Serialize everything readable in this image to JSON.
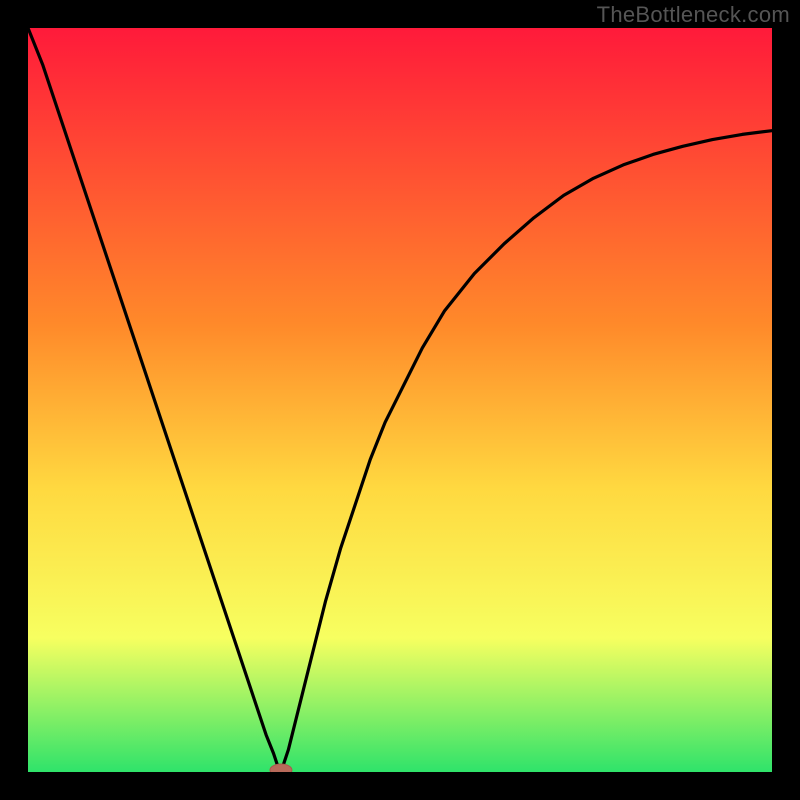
{
  "watermark": "TheBottleneck.com",
  "colors": {
    "bg": "#000000",
    "grad_top": "#ff1a3a",
    "grad_mid1": "#ff8a2a",
    "grad_mid2": "#ffd940",
    "grad_mid3": "#f7ff60",
    "grad_bottom": "#2fe36a",
    "curve": "#000000",
    "marker_fill": "#b86a5a",
    "marker_stroke": "#a85a4c"
  },
  "chart_data": {
    "type": "line",
    "title": "",
    "xlabel": "",
    "ylabel": "",
    "xlim": [
      0,
      100
    ],
    "ylim": [
      0,
      100
    ],
    "series": [
      {
        "name": "left-branch",
        "x": [
          0,
          2,
          4,
          6,
          8,
          10,
          12,
          14,
          16,
          18,
          20,
          22,
          24,
          26,
          28,
          30,
          31,
          32,
          33,
          33.5,
          34
        ],
        "values": [
          100,
          95,
          89,
          83,
          77,
          71,
          65,
          59,
          53,
          47,
          41,
          35,
          29,
          23,
          17,
          11,
          8,
          5,
          2.5,
          1,
          0
        ]
      },
      {
        "name": "right-branch",
        "x": [
          34,
          35,
          36,
          37,
          38,
          39,
          40,
          42,
          44,
          46,
          48,
          50,
          53,
          56,
          60,
          64,
          68,
          72,
          76,
          80,
          84,
          88,
          92,
          96,
          100
        ],
        "values": [
          0,
          3,
          7,
          11,
          15,
          19,
          23,
          30,
          36,
          42,
          47,
          51,
          57,
          62,
          67,
          71,
          74.5,
          77.5,
          79.8,
          81.6,
          83.0,
          84.1,
          85.0,
          85.7,
          86.2
        ]
      }
    ],
    "markers": [
      {
        "name": "vertex-marker",
        "x": 34,
        "y": 0
      }
    ],
    "gradient_stops": [
      {
        "pos": 0.0,
        "key": "grad_top"
      },
      {
        "pos": 0.4,
        "key": "grad_mid1"
      },
      {
        "pos": 0.62,
        "key": "grad_mid2"
      },
      {
        "pos": 0.82,
        "key": "grad_mid3"
      },
      {
        "pos": 1.0,
        "key": "grad_bottom"
      }
    ]
  }
}
